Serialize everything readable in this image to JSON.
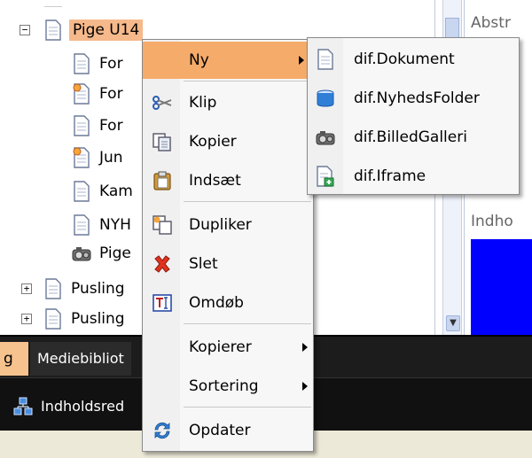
{
  "tree": {
    "root": {
      "label": "Pige U14",
      "expander": "−"
    },
    "children": [
      {
        "label": "For",
        "icon": "document-icon"
      },
      {
        "label": "For",
        "icon": "document-star-icon"
      },
      {
        "label": "For",
        "icon": "document-icon"
      },
      {
        "label": "Jun",
        "icon": "document-star-icon"
      },
      {
        "label": "Kam",
        "icon": "document-icon"
      },
      {
        "label": "NYH",
        "icon": "document-icon"
      },
      {
        "label": "Pige",
        "icon": "gallery-icon"
      }
    ],
    "siblings": [
      {
        "label": "Pusling",
        "expander": "+",
        "icon": "document-icon"
      },
      {
        "label": "Pusling",
        "expander": "+",
        "icon": "document-icon"
      }
    ]
  },
  "right_panel": {
    "abstract_label": "Abstr",
    "content_label": "Indho"
  },
  "tabs": {
    "active_fragment": "g",
    "media_tab": "Mediebibliot",
    "content_tab": "Indholdsred"
  },
  "context_menu": {
    "items": [
      {
        "label": "Ny",
        "icon": "none",
        "submenu": true,
        "highlighted": true
      },
      {
        "label": "Klip",
        "icon": "scissors-icon"
      },
      {
        "label": "Kopier",
        "icon": "copy-icon"
      },
      {
        "label": "Indsæt",
        "icon": "paste-icon"
      },
      {
        "label": "Dupliker",
        "icon": "duplicate-icon"
      },
      {
        "label": "Slet",
        "icon": "delete-icon"
      },
      {
        "label": "Omdøb",
        "icon": "rename-icon"
      },
      {
        "label": "Kopierer",
        "icon": "none",
        "submenu": true
      },
      {
        "label": "Sortering",
        "icon": "none",
        "submenu": true
      },
      {
        "label": "Opdater",
        "icon": "refresh-icon"
      }
    ]
  },
  "submenu": {
    "items": [
      {
        "label": "dif.Dokument",
        "icon": "document-icon"
      },
      {
        "label": "dif.NyhedsFolder",
        "icon": "folder-icon"
      },
      {
        "label": "dif.BilledGalleri",
        "icon": "gallery-icon"
      },
      {
        "label": "dif.Iframe",
        "icon": "iframe-icon"
      }
    ]
  },
  "colors": {
    "highlight": "#f5ab6a",
    "root_selection": "#f6b98b",
    "content_blue": "#0000ff",
    "dark_bar": "#1c1c1c"
  }
}
